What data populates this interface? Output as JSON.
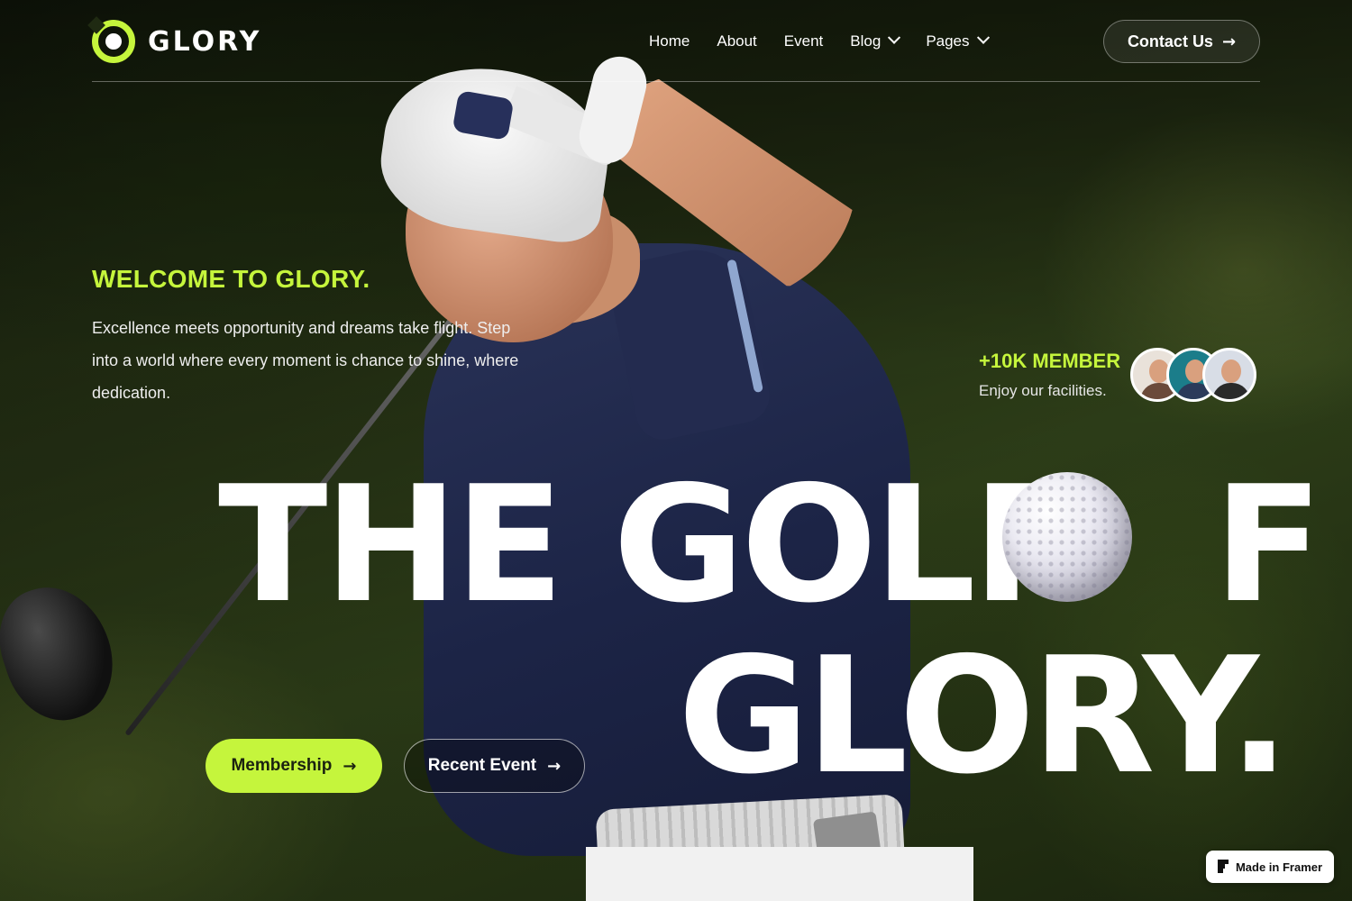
{
  "brand": {
    "name": "GLORY",
    "accent": "#c5f53c"
  },
  "nav": {
    "items": [
      {
        "label": "Home",
        "dropdown": false
      },
      {
        "label": "About",
        "dropdown": false
      },
      {
        "label": "Event",
        "dropdown": false
      },
      {
        "label": "Blog",
        "dropdown": true
      },
      {
        "label": "Pages",
        "dropdown": true
      }
    ],
    "contact_label": "Contact Us"
  },
  "hero": {
    "welcome": "WELCOME TO GLORY.",
    "intro": "Excellence meets opportunity and dreams take flight. Step into a world where every moment is chance to shine, where dedication.",
    "headline_line1_part1": "THE GOLF",
    "headline_line1_part2": "F",
    "headline_line2": "GLORY.",
    "membership_label": "Membership",
    "recent_event_label": "Recent Event"
  },
  "members": {
    "count": "+10K MEMBER",
    "subtitle": "Enjoy our facilities.",
    "avatars": [
      {
        "bg": "#e9e2da",
        "shirt": "#6b4a3a"
      },
      {
        "bg": "#1b7d8a",
        "shirt": "#2b3a5a"
      },
      {
        "bg": "#d8dde6",
        "shirt": "#2a2a2a"
      }
    ]
  },
  "badge": {
    "label": "Made in Framer"
  }
}
